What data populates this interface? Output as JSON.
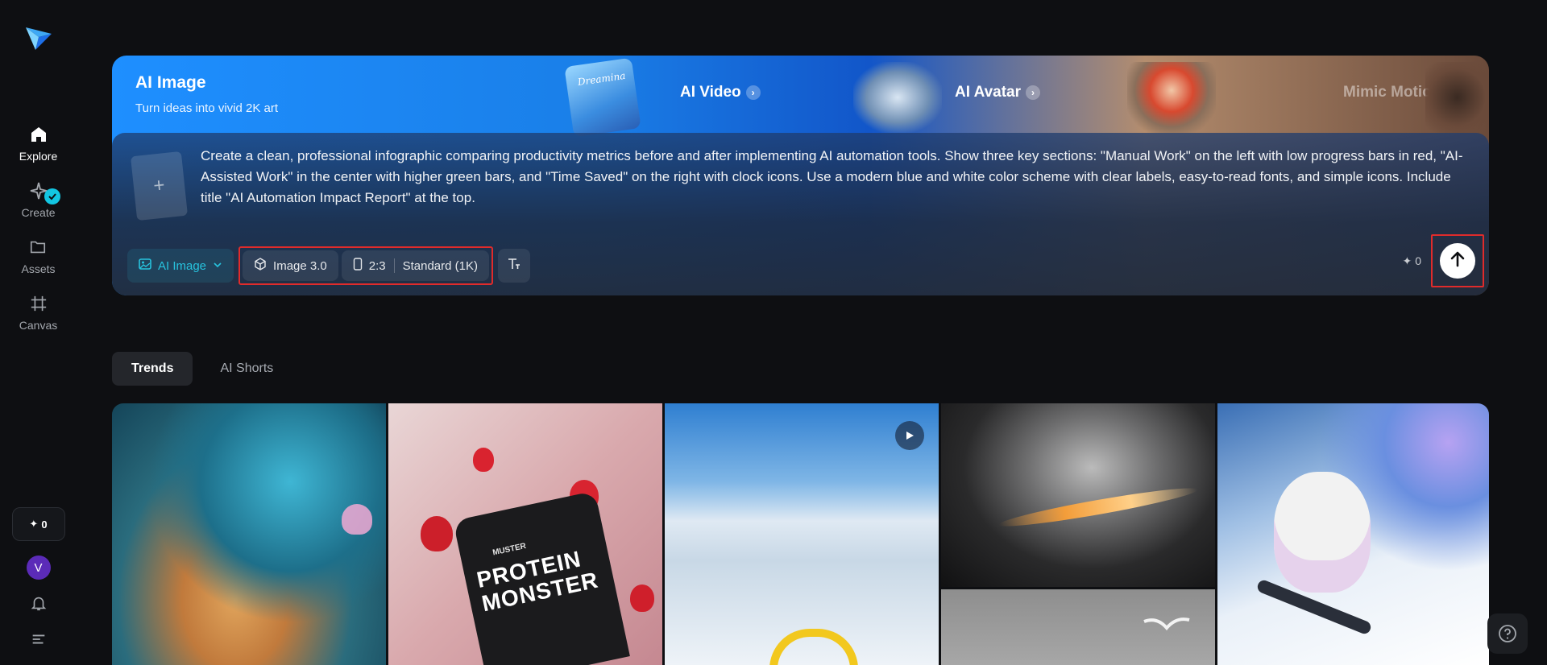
{
  "sidebar": {
    "items": [
      {
        "label": "Explore",
        "icon": "home-icon"
      },
      {
        "label": "Create",
        "icon": "create-icon"
      },
      {
        "label": "Assets",
        "icon": "folder-icon"
      },
      {
        "label": "Canvas",
        "icon": "canvas-icon"
      }
    ],
    "credits": "0",
    "avatar_initial": "V"
  },
  "hero": {
    "title": "AI Image",
    "subtitle": "Turn ideas into vivid 2K art",
    "promos": [
      {
        "label": "AI Video",
        "thumb_text": "Dreamina"
      },
      {
        "label": "AI Avatar"
      },
      {
        "label": "Mimic Motion"
      }
    ]
  },
  "prompt": {
    "text": "Create a clean, professional infographic comparing productivity metrics before and after implementing AI automation tools. Show three key sections: \"Manual Work\" on the left with low progress bars in red, \"AI-Assisted Work\" in the center with higher green bars, and \"Time Saved\" on the right with clock icons. Use a modern blue and white color scheme with clear labels, easy-to-read fonts, and simple icons. Include title \"AI Automation Impact Report\" at the top."
  },
  "toolbar": {
    "mode_label": "AI Image",
    "model_label": "Image 3.0",
    "ratio_label": "2:3",
    "quality_label": "Standard (1K)",
    "credits": "0"
  },
  "tabs": [
    {
      "label": "Trends",
      "active": true
    },
    {
      "label": "AI Shorts",
      "active": false
    }
  ],
  "gallery": {
    "items": [
      {
        "name": "underwater-isometric-ruins",
        "alt": ""
      },
      {
        "name": "protein-monster-strawberries",
        "label": "PROTEIN MONSTER",
        "brand": "MUSTER"
      },
      {
        "name": "paraglider-snow-canyon",
        "video": true
      },
      {
        "name": "stone-face-sculpture"
      },
      {
        "name": "seagull-grey"
      },
      {
        "name": "polar-bear-snowboard"
      }
    ]
  },
  "colors": {
    "accent": "#13c6e2",
    "highlight_border": "#e02b2b",
    "background": "#0e0f12"
  }
}
